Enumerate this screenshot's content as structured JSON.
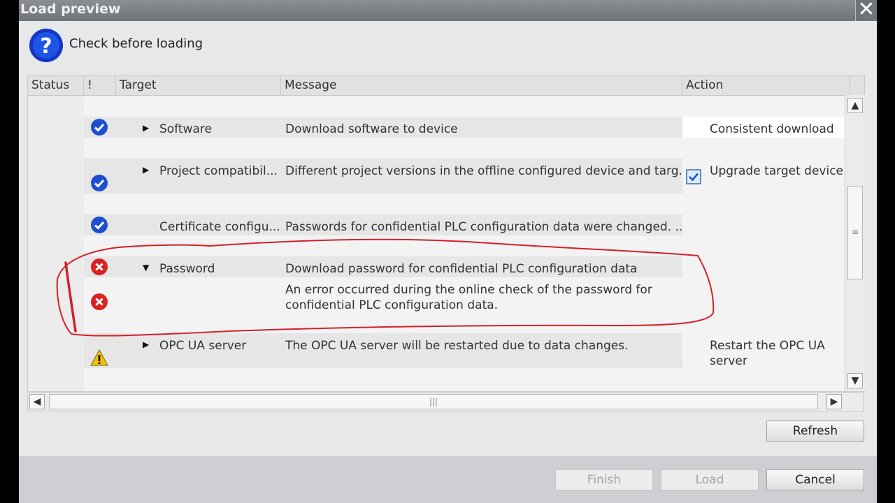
{
  "window": {
    "title": "Load preview",
    "close_glyph": "✕"
  },
  "header": {
    "icon": "question-icon",
    "text": "Check before loading"
  },
  "columns": {
    "status": "Status",
    "excl": "!",
    "target": "Target",
    "message": "Message",
    "action": "Action"
  },
  "rows": {
    "software": {
      "target": "Software",
      "message": "Download software to device",
      "action": "Consistent download",
      "status_icon": "check-icon"
    },
    "compat": {
      "target": "Project compatibil...",
      "message": "Different project versions in the offline configured device and targ.",
      "action": "Upgrade target device.",
      "status_icon": "check-icon",
      "checked": true
    },
    "cert": {
      "target": "Certificate configu...",
      "message": "Passwords for confidential PLC configuration data were changed. ..",
      "status_icon": "check-icon"
    },
    "password": {
      "target": "Password",
      "message": "Download password for confidential PLC configuration data",
      "status_icon": "error-icon"
    },
    "password_error": {
      "message": "An error occurred during the online check of the password for confidential PLC configuration data.",
      "status_icon": "error-icon"
    },
    "opcua": {
      "target": "OPC UA server",
      "message": "The OPC UA server will be restarted due to data changes.",
      "action": "Restart the OPC UA server",
      "status_icon": "warning-icon"
    }
  },
  "buttons": {
    "refresh": "Refresh",
    "finish": "Finish",
    "load": "Load",
    "cancel": "Cancel"
  },
  "scroll": {
    "up": "▲",
    "down": "▼",
    "left": "◀",
    "right": "▶",
    "grip_v": "≡",
    "grip_h": "|||"
  },
  "colors": {
    "check": "#1f4fd0",
    "error": "#d92222",
    "warning": "#f2c200",
    "annotation": "#d4202a"
  }
}
